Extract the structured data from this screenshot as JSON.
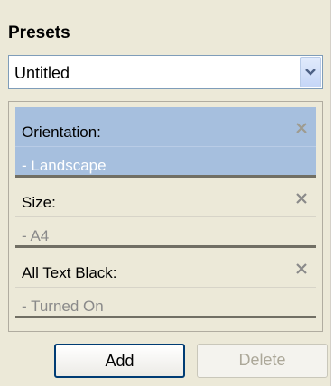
{
  "presets": {
    "title": "Presets",
    "selected_value": "Untitled",
    "items": [
      {
        "label": "Orientation:",
        "value": "- Landscape",
        "selected": true
      },
      {
        "label": "Size:",
        "value": "- A4",
        "selected": false
      },
      {
        "label": "All Text Black:",
        "value": "- Turned On",
        "selected": false
      }
    ],
    "add_label": "Add",
    "delete_label": "Delete"
  },
  "colors": {
    "panel_bg": "#ece9d8",
    "selected_bg": "#a6bfde",
    "separator": "#716f64",
    "accent_border": "#003c74"
  },
  "icons": {
    "dropdown": "chevron-down-icon",
    "remove": "close-icon"
  }
}
